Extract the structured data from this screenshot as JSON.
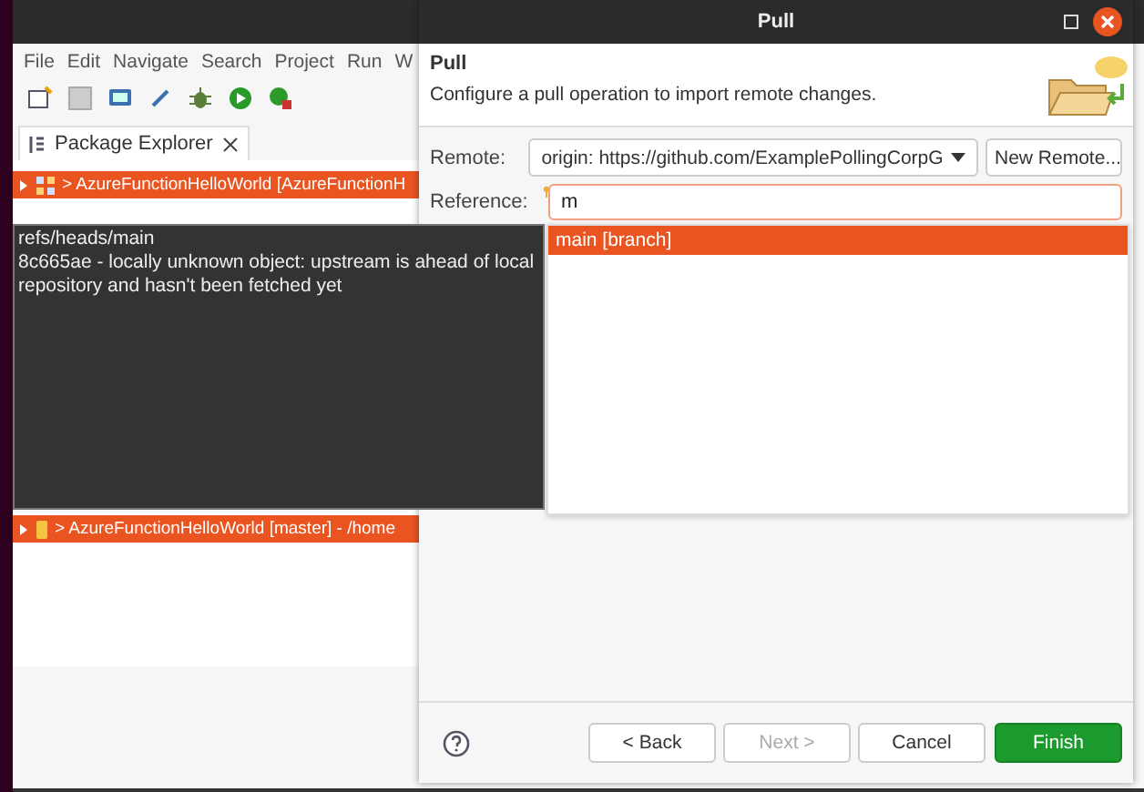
{
  "eclipse": {
    "menu": [
      "File",
      "Edit",
      "Navigate",
      "Search",
      "Project",
      "Run",
      "W"
    ],
    "view_tab": {
      "label": "Package Explorer"
    },
    "projects": [
      {
        "label": "> AzureFunctionHelloWorld [AzureFunctionH",
        "selected": true,
        "kind": "project"
      },
      {
        "label": "> AzureFunctionHelloWorld [master] - /home",
        "selected": true,
        "kind": "repository"
      }
    ]
  },
  "tooltip": {
    "lines": [
      "refs/heads/main",
      "8c665ae - locally unknown object: upstream is ahead of local repository and hasn't been fetched yet"
    ]
  },
  "dialog": {
    "title": "Pull",
    "heading": "Pull",
    "description": "Configure a pull operation to import remote changes.",
    "remote": {
      "label": "Remote:",
      "value": "origin: https://github.com/ExamplePollingCorpG"
    },
    "new_remote_button": "New Remote...",
    "reference": {
      "label": "Reference:",
      "value": "m"
    },
    "suggestions": [
      {
        "label": "main [branch]",
        "selected": true
      }
    ],
    "buttons": [
      {
        "label": "< Back",
        "kind": "normal",
        "disabled": false
      },
      {
        "label": "Next >",
        "kind": "normal",
        "disabled": true
      },
      {
        "label": "Cancel",
        "kind": "normal",
        "disabled": false
      },
      {
        "label": "Finish",
        "kind": "primary",
        "disabled": false
      }
    ]
  }
}
